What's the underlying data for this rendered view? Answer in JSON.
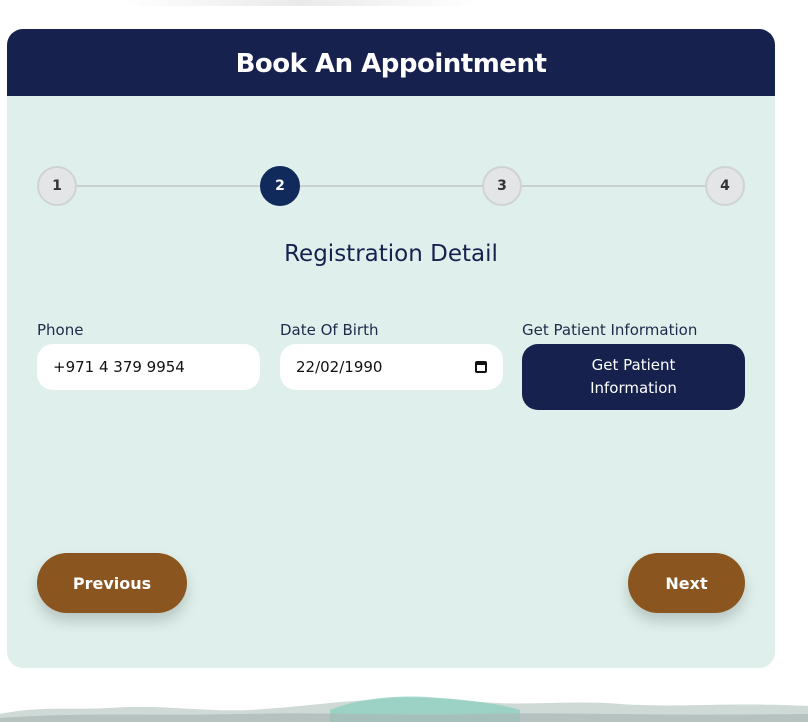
{
  "header": {
    "title": "Book An Appointment"
  },
  "stepper": {
    "steps": [
      "1",
      "2",
      "3",
      "4"
    ],
    "active_step": 2
  },
  "section": {
    "title": "Registration Detail"
  },
  "form": {
    "phone": {
      "label": "Phone",
      "value": "+971 4 379 9954"
    },
    "dob": {
      "label": "Date Of Birth",
      "value": "22/02/1990"
    },
    "patient_info": {
      "label": "Get Patient Information",
      "button_label": "Get Patient Information"
    }
  },
  "nav": {
    "previous_label": "Previous",
    "next_label": "Next"
  },
  "colors": {
    "header_bg": "#16214e",
    "card_bg": "#dff0ec",
    "active_step": "#0f2a5b",
    "nav_button": "#8b551f"
  }
}
